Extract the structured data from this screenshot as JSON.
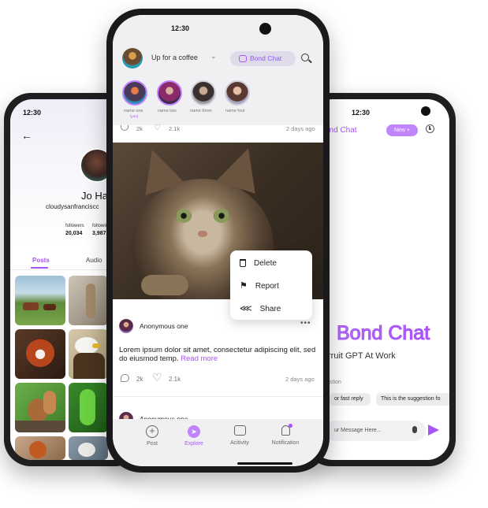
{
  "left_phone": {
    "time": "12:30",
    "profile_name": "Jo Ha",
    "profile_handle": "cloudysanfranciscc",
    "stats": [
      {
        "label": "followers",
        "value": "20,034"
      },
      {
        "label": "followin",
        "value": "3,987"
      }
    ],
    "tabs": [
      {
        "label": "Posts"
      },
      {
        "label": "Audio"
      }
    ]
  },
  "center_phone": {
    "time": "12:30",
    "status_text": "Up for a coffee",
    "bond_chat_label": "Bond Chat",
    "stories": [
      {
        "name": "name one",
        "sub": "(you)"
      },
      {
        "name": "name two",
        "sub": ""
      },
      {
        "name": "name three",
        "sub": ""
      },
      {
        "name": "name four",
        "sub": ""
      }
    ],
    "prev_post": {
      "comments": "2k",
      "likes": "2.1k",
      "age": "2 days ago"
    },
    "context_menu": [
      {
        "label": "Delete",
        "icon": "trash-icon"
      },
      {
        "label": "Report",
        "icon": "flag-icon"
      },
      {
        "label": "Share",
        "icon": "share-icon"
      }
    ],
    "post": {
      "author": "Anonymous one",
      "body": "Lorem ipsum dolor sit amet, consectetur adipiscing elit, sed do eiusmod temp.",
      "read_more": "Read more",
      "comments": "2k",
      "likes": "2.1k",
      "age": "2 days ago"
    },
    "next_post_author": "Anonymous one",
    "nav": [
      {
        "label": "Post",
        "icon": "plus-circle-icon"
      },
      {
        "label": "Explore",
        "icon": "compass-icon"
      },
      {
        "label": "Acitivity",
        "icon": "chat-bubble-icon"
      },
      {
        "label": "Notification",
        "icon": "bell-icon"
      }
    ],
    "accent_color": "#a855f7"
  },
  "right_phone": {
    "time": "12:30",
    "title": "ond Chat",
    "new_button": "New +",
    "comma": ",",
    "hero_title": "Bond Chat",
    "subtitle": "rruit GPT At Work",
    "suggestion_heading": "stion",
    "suggestions": [
      {
        "label": "or fast reply"
      },
      {
        "label": "This is the suggestion fo"
      }
    ],
    "input_placeholder": "ur Message Here..."
  }
}
